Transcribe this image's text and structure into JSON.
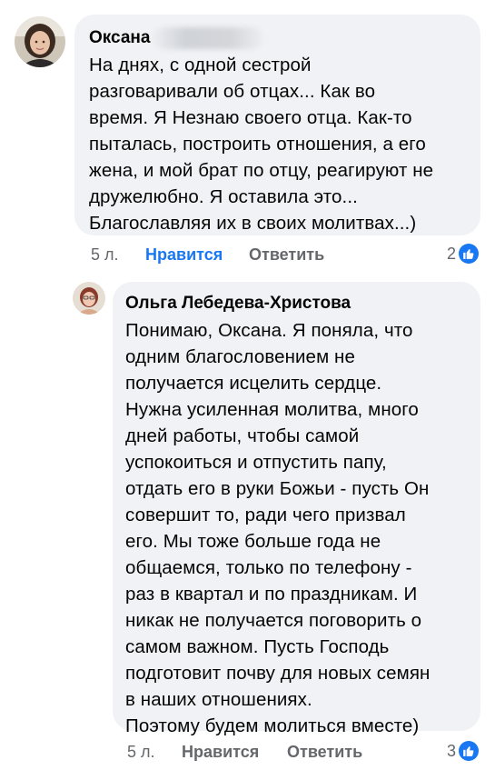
{
  "comments": [
    {
      "author": "Оксана",
      "text": "На днях,  с одной сестрой\nразговаривали об отцах... Как во\nвремя. Я Незнаю  своего отца. Как-то\nпыталась, построить отношения, а его\nжена, и мой брат по отцу, реагируют не\nдружелюбно. Я оставила это...\nБлагославляя их в своих молитвах...)",
      "age": "5 л.",
      "like_label": "Нравится",
      "reply_label": "Ответить",
      "reaction_count": "2",
      "liked": true
    },
    {
      "author": "Ольга Лебедева-Христова",
      "text": "Понимаю, Оксана. Я поняла, что\nодним благословением не\nполучается исцелить сердце.\nНужна усиленная молитва, много\nдней работы, чтобы самой\nуспокоиться и отпустить папу,\nотдать его в руки Божьи - пусть Он\nсовершит то, ради чего призвал\nего. Мы тоже больше года не\nобщаемся, только по телефону -\nраз в квартал и по праздникам. И\nникак не получается поговорить о\nсамом важном. Пусть Господь\nподготовит почву для новых семян\nв наших отношениях.\nПоэтому будем молиться вместе)",
      "age": "5 л.",
      "like_label": "Нравится",
      "reply_label": "Ответить",
      "reaction_count": "3",
      "liked": false
    }
  ],
  "colors": {
    "bubble": "#f0f2f5",
    "meta_text": "#65676b",
    "like_active": "#1877f2",
    "reaction_badge": "#1877f2"
  },
  "icons": {
    "reaction": "thumbs-up-icon"
  }
}
